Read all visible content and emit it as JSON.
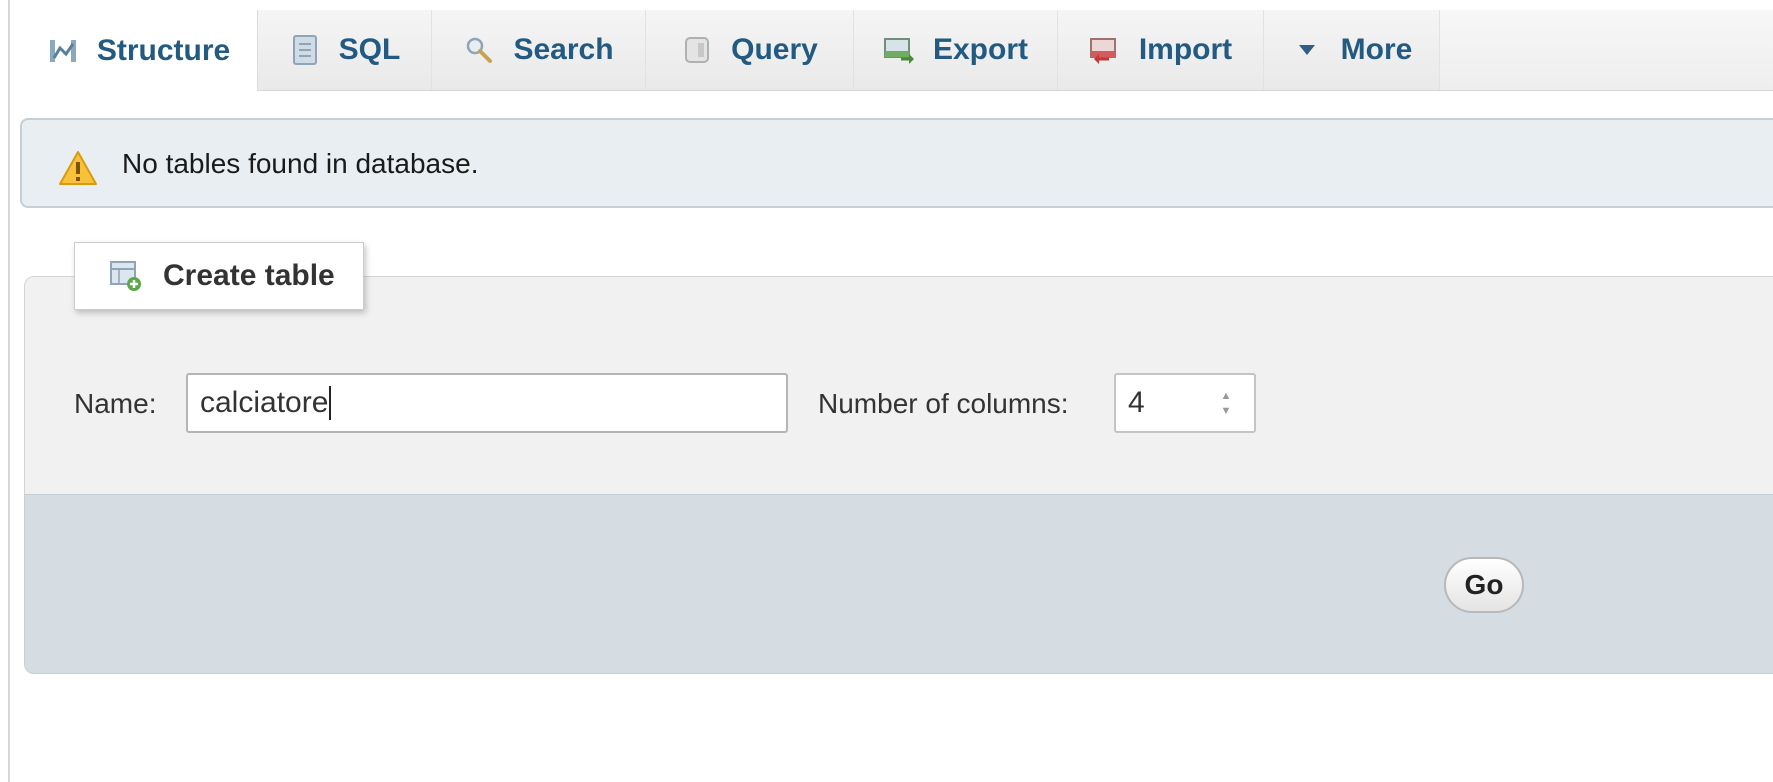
{
  "tabs": [
    {
      "label": "Structure",
      "icon": "structure-icon",
      "active": true
    },
    {
      "label": "SQL",
      "icon": "sql-icon"
    },
    {
      "label": "Search",
      "icon": "search-icon"
    },
    {
      "label": "Query",
      "icon": "query-icon"
    },
    {
      "label": "Export",
      "icon": "export-icon"
    },
    {
      "label": "Import",
      "icon": "import-icon"
    },
    {
      "label": "More",
      "icon": "caret-down-icon"
    }
  ],
  "notice": {
    "icon": "warning-icon",
    "message": "No tables found in database."
  },
  "create_table": {
    "legend": "Create table",
    "icon": "create-table-icon",
    "name_label": "Name:",
    "name_value": "calciatore",
    "columns_label": "Number of columns:",
    "columns_value": "4",
    "go_label": "Go"
  },
  "colors": {
    "tab_text": "#235a81",
    "notice_bg": "#e8eef1",
    "fieldset_bg": "#f1f1f1",
    "actionbar_bg": "#d5dde3",
    "warning": "#f4b400"
  }
}
